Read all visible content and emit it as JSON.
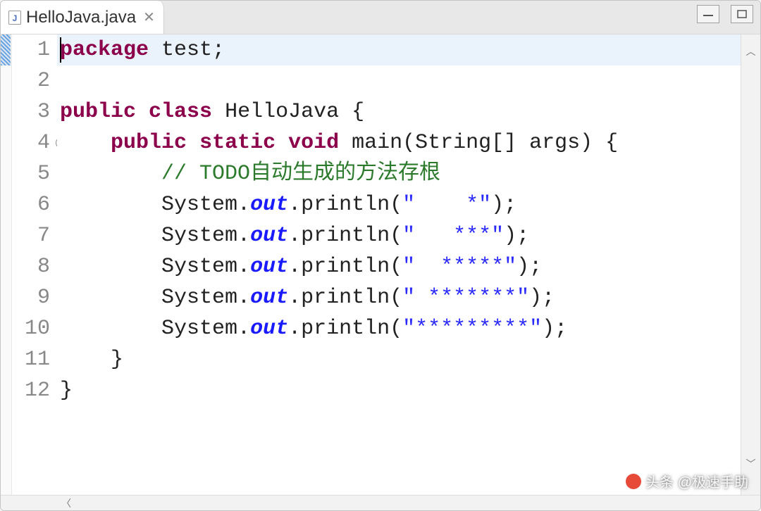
{
  "tab": {
    "filename": "HelloJava.java"
  },
  "lines": [
    {
      "num": 1,
      "indent": 0,
      "tokens": [
        [
          "kw",
          "package"
        ],
        [
          "plain",
          " test;"
        ]
      ]
    },
    {
      "num": 2,
      "indent": 0,
      "tokens": []
    },
    {
      "num": 3,
      "indent": 0,
      "tokens": [
        [
          "kw",
          "public"
        ],
        [
          "plain",
          " "
        ],
        [
          "kw",
          "class"
        ],
        [
          "plain",
          " HelloJava {"
        ]
      ]
    },
    {
      "num": 4,
      "indent": 1,
      "tokens": [
        [
          "kw",
          "public"
        ],
        [
          "plain",
          " "
        ],
        [
          "kw",
          "static"
        ],
        [
          "plain",
          " "
        ],
        [
          "type",
          "void"
        ],
        [
          "plain",
          " main(String[] args) {"
        ]
      ],
      "fold": "⊖"
    },
    {
      "num": 5,
      "indent": 2,
      "tokens": [
        [
          "comment",
          "// TODO自动生成的方法存根"
        ]
      ]
    },
    {
      "num": 6,
      "indent": 2,
      "tokens": [
        [
          "plain",
          "System."
        ],
        [
          "field",
          "out"
        ],
        [
          "plain",
          ".println("
        ],
        [
          "str",
          "\"    *\""
        ],
        [
          "plain",
          ");"
        ]
      ]
    },
    {
      "num": 7,
      "indent": 2,
      "tokens": [
        [
          "plain",
          "System."
        ],
        [
          "field",
          "out"
        ],
        [
          "plain",
          ".println("
        ],
        [
          "str",
          "\"   ***\""
        ],
        [
          "plain",
          ");"
        ]
      ]
    },
    {
      "num": 8,
      "indent": 2,
      "tokens": [
        [
          "plain",
          "System."
        ],
        [
          "field",
          "out"
        ],
        [
          "plain",
          ".println("
        ],
        [
          "str",
          "\"  *****\""
        ],
        [
          "plain",
          ");"
        ]
      ]
    },
    {
      "num": 9,
      "indent": 2,
      "tokens": [
        [
          "plain",
          "System."
        ],
        [
          "field",
          "out"
        ],
        [
          "plain",
          ".println("
        ],
        [
          "str",
          "\" *******\""
        ],
        [
          "plain",
          ");"
        ]
      ]
    },
    {
      "num": 10,
      "indent": 2,
      "tokens": [
        [
          "plain",
          "System."
        ],
        [
          "field",
          "out"
        ],
        [
          "plain",
          ".println("
        ],
        [
          "str",
          "\"*********\""
        ],
        [
          "plain",
          ");"
        ]
      ]
    },
    {
      "num": 11,
      "indent": 1,
      "tokens": [
        [
          "plain",
          "}"
        ]
      ]
    },
    {
      "num": 12,
      "indent": 0,
      "tokens": [
        [
          "plain",
          "}"
        ]
      ]
    }
  ],
  "highlight_line": 1,
  "cursor_line": 1,
  "cursor_col": 0,
  "watermark": "头条 @极速手助"
}
